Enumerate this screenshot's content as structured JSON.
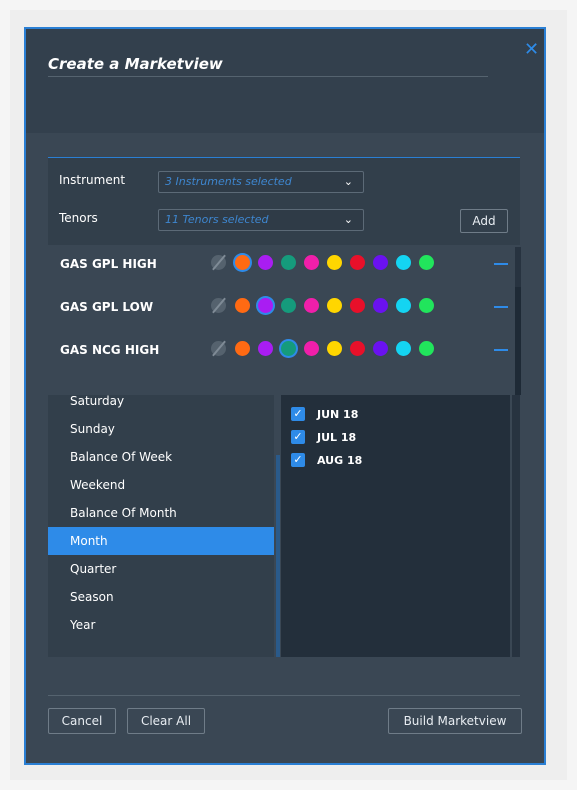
{
  "modal": {
    "title": "Create a Marketview",
    "close_icon": "close-icon"
  },
  "selection": {
    "instrument_label": "Instrument",
    "instrument_value": "3 Instruments selected",
    "tenors_label": "Tenors",
    "tenors_value": "11 Tenors selected",
    "add_label": "Add"
  },
  "colors": [
    "#ff6a13",
    "#a91df2",
    "#159b7c",
    "#f01faa",
    "#ffd600",
    "#e8102a",
    "#6a12f0",
    "#14d4f2",
    "#21e55c"
  ],
  "instruments": [
    {
      "name": "GAS GPL HIGH",
      "selected_color_index": 0
    },
    {
      "name": "GAS GPL LOW",
      "selected_color_index": 1
    },
    {
      "name": "GAS NCG HIGH",
      "selected_color_index": 2
    }
  ],
  "tenor_types": [
    {
      "label": "Saturday",
      "active": false
    },
    {
      "label": "Sunday",
      "active": false
    },
    {
      "label": "Balance Of Week",
      "active": false
    },
    {
      "label": "Weekend",
      "active": false
    },
    {
      "label": "Balance Of Month",
      "active": false
    },
    {
      "label": "Month",
      "active": true
    },
    {
      "label": "Quarter",
      "active": false
    },
    {
      "label": "Season",
      "active": false
    },
    {
      "label": "Year",
      "active": false
    }
  ],
  "months": [
    {
      "label": "JUN 18",
      "checked": true
    },
    {
      "label": "JUL 18",
      "checked": true
    },
    {
      "label": "AUG 18",
      "checked": true
    }
  ],
  "footer": {
    "cancel_label": "Cancel",
    "clear_label": "Clear All",
    "build_label": "Build Marketview"
  }
}
